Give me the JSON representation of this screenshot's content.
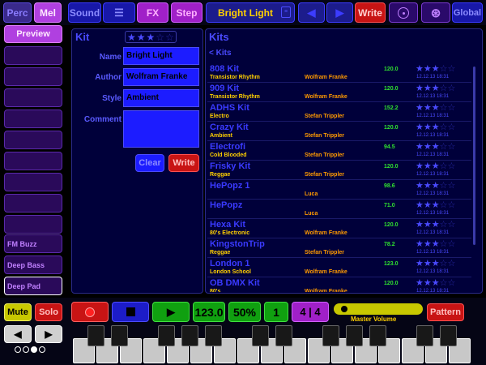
{
  "topbar": {
    "perc_label": "Perc",
    "mel_label": "Mel",
    "sound_label": "Sound",
    "menu_icon": "☰",
    "fx_label": "FX",
    "step_label": "Step",
    "kit_name": "Bright Light",
    "write_label": "Write",
    "global_label": "Global"
  },
  "sidebar": {
    "preview_label": "Preview",
    "slots": [
      "",
      "",
      "",
      "",
      "",
      "",
      "",
      "",
      "",
      "",
      "FM Buzz",
      "Deep Bass",
      "Deep Pad"
    ]
  },
  "kit_panel": {
    "title": "Kit",
    "rating": 3,
    "name_label": "Name",
    "name_value": "Bright Light",
    "author_label": "Author",
    "author_value": "Wolfram Franke",
    "style_label": "Style",
    "style_value": "Ambient",
    "comment_label": "Comment",
    "comment_value": "",
    "clear_label": "Clear",
    "write_label": "Write"
  },
  "kits_panel": {
    "title": "Kits",
    "breadcrumb": "< Kits",
    "rows": [
      {
        "name": "808 Kit",
        "genre": "Transistor Rhythm",
        "author": "Wolfram Franke",
        "bpm": "120.0",
        "rating": 3,
        "date": "12.12.13 18:31"
      },
      {
        "name": "909 Kit",
        "genre": "Transistor Rhythm",
        "author": "Wolfram Franke",
        "bpm": "120.0",
        "rating": 3,
        "date": "12.12.13 18:31"
      },
      {
        "name": "ADHS Kit",
        "genre": "Electro",
        "author": "Stefan Trippler",
        "bpm": "152.2",
        "rating": 3,
        "date": "12.12.13 18:31"
      },
      {
        "name": "Crazy Kit",
        "genre": "Ambient",
        "author": "Stefan Trippler",
        "bpm": "120.0",
        "rating": 3,
        "date": "12.12.13 18:31"
      },
      {
        "name": "Electrofi",
        "genre": "Cold Blooded",
        "author": "Stefan Trippler",
        "bpm": "94.5",
        "rating": 3,
        "date": "12.12.13 18:31"
      },
      {
        "name": "Frisky Kit",
        "genre": "Reggae",
        "author": "Stefan Trippler",
        "bpm": "120.0",
        "rating": 3,
        "date": "12.12.13 18:31"
      },
      {
        "name": "HePopz 1",
        "genre": "",
        "author": "Luca",
        "bpm": "98.6",
        "rating": 3,
        "date": "12.12.13 18:31"
      },
      {
        "name": "HePopz",
        "genre": "",
        "author": "Luca",
        "bpm": "71.0",
        "rating": 3,
        "date": "12.12.13 18:31"
      },
      {
        "name": "Hexa Kit",
        "genre": "80's Electronic",
        "author": "Wolfram Franke",
        "bpm": "120.0",
        "rating": 3,
        "date": "12.12.13 18:31"
      },
      {
        "name": "KingstonTrip",
        "genre": "Reggae",
        "author": "Stefan Trippler",
        "bpm": "78.2",
        "rating": 3,
        "date": "12.12.13 18:31"
      },
      {
        "name": "London 1",
        "genre": "London School",
        "author": "Wolfram Franke",
        "bpm": "123.0",
        "rating": 3,
        "date": "12.12.13 18:31"
      },
      {
        "name": "OB DMX Kit",
        "genre": "80's",
        "author": "Wolfram Franke",
        "bpm": "120.0",
        "rating": 3,
        "date": "12.12.13 18:31"
      }
    ]
  },
  "transport": {
    "mute_label": "Mute",
    "solo_label": "Solo",
    "tempo": "123.0",
    "swing": "50%",
    "bar": "1",
    "time_signature": "4 | 4",
    "master_volume_label": "Master Volume",
    "master_volume_level": 0.05,
    "pattern_label": "Pattern",
    "prev_icon": "◀",
    "next_icon": "▶",
    "page_count": 4,
    "active_page": 1
  },
  "colors": {
    "accent_blue": "#3a3aff",
    "magenta": "#a020c8",
    "record_red": "#c81414",
    "play_green": "#10a010",
    "yellow": "#c8c800"
  }
}
